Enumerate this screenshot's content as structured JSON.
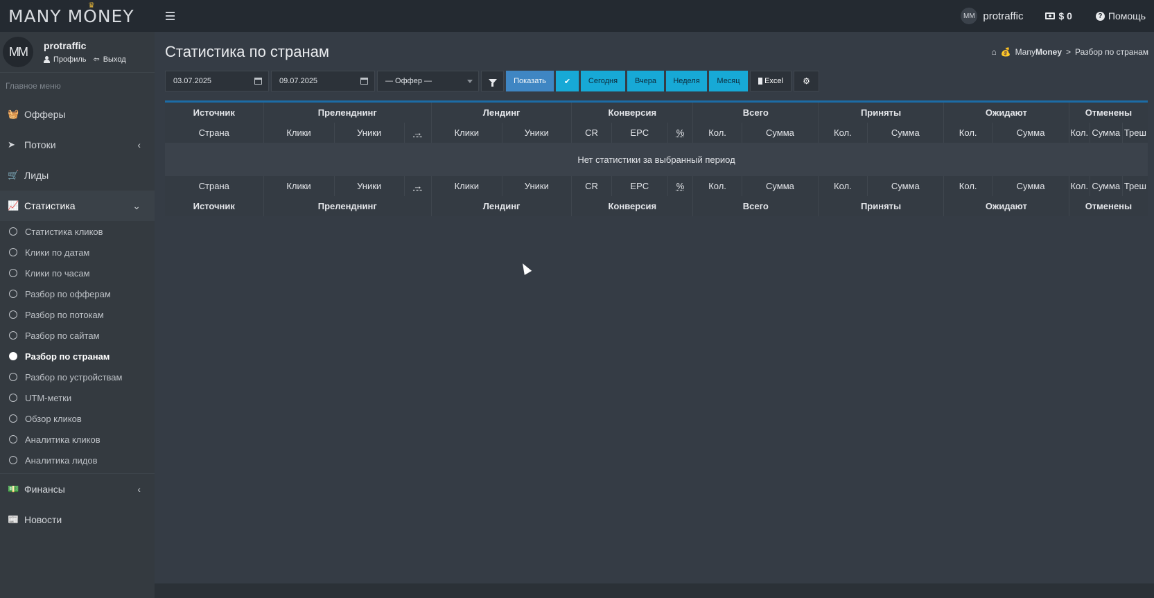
{
  "navbar": {
    "brand": "MANY MONEY",
    "brand_crown": "♛",
    "user_avatar": "M͓M",
    "user_name": "protraffic",
    "balance": "$ 0",
    "help": "Помощь"
  },
  "sidebar": {
    "avatar": "MM",
    "user_name": "protraffic",
    "profile_link": "Профиль",
    "logout_link": "Выход",
    "menu_header": "Главное меню",
    "items": [
      {
        "label": "Офферы",
        "icon": "basket-icon"
      },
      {
        "label": "Потоки",
        "icon": "paper-plane-icon"
      },
      {
        "label": "Лиды",
        "icon": "cart-icon"
      },
      {
        "label": "Статистика",
        "icon": "chart-area-icon"
      },
      {
        "label": "Финансы",
        "icon": "money-icon"
      },
      {
        "label": "Новости",
        "icon": "newspaper-icon"
      }
    ],
    "stats_submenu": [
      "Статистика кликов",
      "Клики по датам",
      "Клики по часам",
      "Разбор по офферам",
      "Разбор по потокам",
      "Разбор по сайтам",
      "Разбор по странам",
      "Разбор по устройствам",
      "UTM-метки",
      "Обзор кликов",
      "Аналитика кликов",
      "Аналитика лидов"
    ]
  },
  "main": {
    "title": "Статистика по странам",
    "breadcrumb": {
      "brand_prefix": "Many",
      "brand_bold": "Money",
      "separator": ">",
      "current": "Разбор по странам"
    },
    "toolbar": {
      "date_from": "03.07.2025",
      "date_to": "09.07.2025",
      "offer_select": "— Оффер —",
      "show_button": "Показать",
      "check_button": "✔",
      "today_button": "Сегодня",
      "yesterday_button": "Вчера",
      "week_button": "Неделя",
      "month_button": "Месяц",
      "excel_button": "Excel"
    },
    "table": {
      "groups": [
        "Источник",
        "Преленднинг",
        "Лендинг",
        "Конверсия",
        "Всего",
        "Приняты",
        "Ожидают",
        "Отменены"
      ],
      "columns": [
        "Страна",
        "Клики",
        "Уники",
        "→",
        "Клики",
        "Уники",
        "CR",
        "EPC",
        "%",
        "Кол.",
        "Сумма",
        "Кол.",
        "Сумма",
        "Кол.",
        "Сумма",
        "Кол.",
        "Сумма",
        "Треш"
      ],
      "empty_message": "Нет статистики за выбранный период"
    }
  }
}
